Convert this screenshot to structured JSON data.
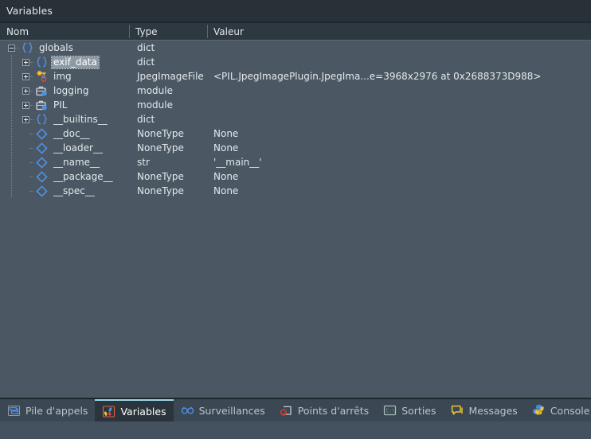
{
  "window": {
    "title": "Variables"
  },
  "columns": [
    {
      "key": "nom",
      "label": "Nom"
    },
    {
      "key": "type",
      "label": "Type"
    },
    {
      "key": "valeur",
      "label": "Valeur"
    }
  ],
  "tree": {
    "rows": [
      {
        "name": "globals",
        "type": "dict",
        "value": "",
        "depth": 0,
        "expander": "minus",
        "icon": "braces-icon",
        "selected": false
      },
      {
        "name": "exif_data",
        "type": "dict",
        "value": "",
        "depth": 1,
        "expander": "plus",
        "icon": "braces-icon",
        "selected": true
      },
      {
        "name": "img",
        "type": "JpegImageFile",
        "value": "<PIL.JpegImagePlugin.JpegIma...e=3968x2976 at 0x2688373D988>",
        "depth": 1,
        "expander": "plus",
        "icon": "object-icon",
        "selected": false
      },
      {
        "name": "logging",
        "type": "module",
        "value": "",
        "depth": 1,
        "expander": "plus",
        "icon": "module-icon",
        "selected": false
      },
      {
        "name": "PIL",
        "type": "module",
        "value": "",
        "depth": 1,
        "expander": "plus",
        "icon": "module-icon",
        "selected": false
      },
      {
        "name": "__builtins__",
        "type": "dict",
        "value": "",
        "depth": 1,
        "expander": "plus",
        "icon": "braces-icon",
        "selected": false
      },
      {
        "name": "__doc__",
        "type": "NoneType",
        "value": "None",
        "depth": 1,
        "expander": "none",
        "icon": "diamond-icon",
        "selected": false
      },
      {
        "name": "__loader__",
        "type": "NoneType",
        "value": "None",
        "depth": 1,
        "expander": "none",
        "icon": "diamond-icon",
        "selected": false
      },
      {
        "name": "__name__",
        "type": "str",
        "value": "'__main__'",
        "depth": 1,
        "expander": "none",
        "icon": "diamond-icon",
        "selected": false
      },
      {
        "name": "__package__",
        "type": "NoneType",
        "value": "None",
        "depth": 1,
        "expander": "none",
        "icon": "diamond-icon",
        "selected": false
      },
      {
        "name": "__spec__",
        "type": "NoneType",
        "value": "None",
        "depth": 1,
        "expander": "none",
        "icon": "diamond-icon",
        "selected": false
      }
    ]
  },
  "tabs": [
    {
      "label": "Pile d'appels",
      "icon": "call-stack-icon",
      "active": false
    },
    {
      "label": "Variables",
      "icon": "variables-icon",
      "active": true
    },
    {
      "label": "Surveillances",
      "icon": "watches-icon",
      "active": false
    },
    {
      "label": "Points d'arrêts",
      "icon": "breakpoints-icon",
      "active": false
    },
    {
      "label": "Sorties",
      "icon": "output-icon",
      "active": false
    },
    {
      "label": "Messages",
      "icon": "messages-icon",
      "active": false
    },
    {
      "label": "Console Python",
      "icon": "python-icon",
      "active": false
    }
  ],
  "colors": {
    "background": "#4b5762",
    "titlebar": "#283137",
    "header": "#2e3840",
    "tabbar": "#3b4854",
    "active_tab": "#2a343c",
    "accent": "#9fd6e4",
    "icon_blue": "#4f8fe0",
    "text": "#e4e9ee"
  }
}
